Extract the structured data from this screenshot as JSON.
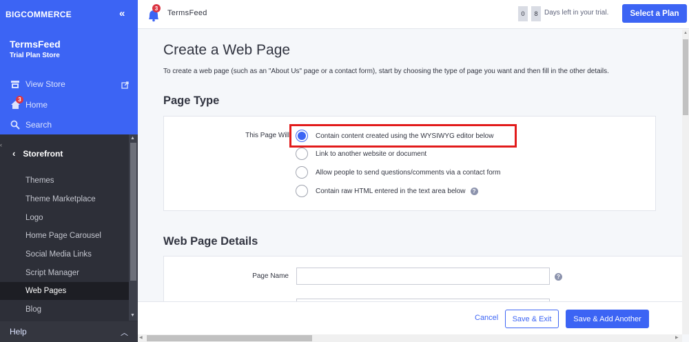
{
  "brand": {
    "logo": "BIGCOMMERCE",
    "accent": "#3c64f4"
  },
  "sidebar": {
    "store_name": "TermsFeed",
    "store_plan": "Trial Plan Store",
    "links": [
      {
        "label": "View Store",
        "icon": "storefront-icon"
      },
      {
        "label": "Home",
        "icon": "home-icon",
        "badge": "3"
      },
      {
        "label": "Search",
        "icon": "search-icon"
      }
    ],
    "section": "Storefront",
    "items": [
      {
        "label": "Themes"
      },
      {
        "label": "Theme Marketplace"
      },
      {
        "label": "Logo"
      },
      {
        "label": "Home Page Carousel"
      },
      {
        "label": "Social Media Links"
      },
      {
        "label": "Script Manager"
      },
      {
        "label": "Web Pages",
        "active": true
      },
      {
        "label": "Blog"
      }
    ],
    "help": "Help"
  },
  "topbar": {
    "notification_count": "3",
    "title": "TermsFeed",
    "days_digits": [
      "0",
      "8"
    ],
    "trial_text": "Days left in your trial.",
    "select_plan": "Select a Plan"
  },
  "main": {
    "title": "Create a Web Page",
    "description": "To create a web page (such as an \"About Us\" page or a contact form), start by choosing the type of page you want and then fill in the other details.",
    "page_type": {
      "heading": "Page Type",
      "label": "This Page Will",
      "options": [
        {
          "label": "Contain content created using the WYSIWYG editor below",
          "selected": true
        },
        {
          "label": "Link to another website or document",
          "selected": false
        },
        {
          "label": "Allow people to send questions/comments via a contact form",
          "selected": false
        },
        {
          "label": "Contain raw HTML entered in the text area below",
          "selected": false,
          "help": "?"
        }
      ]
    },
    "details": {
      "heading": "Web Page Details",
      "page_name_label": "Page Name",
      "page_name_value": "",
      "help": "?"
    }
  },
  "footer": {
    "cancel": "Cancel",
    "save_exit": "Save & Exit",
    "save_add": "Save & Add Another"
  }
}
